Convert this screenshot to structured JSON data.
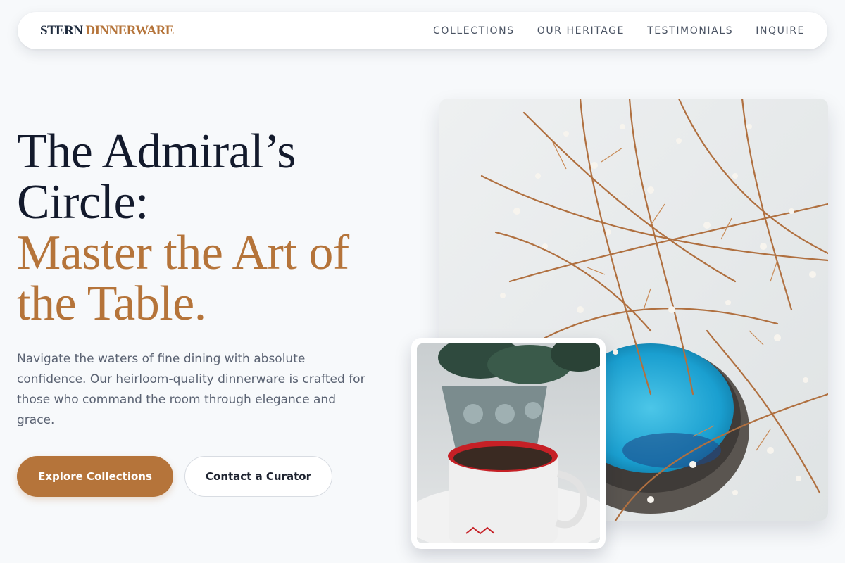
{
  "brand": {
    "part1": "STERN",
    "part2": "DINNERWARE"
  },
  "nav": {
    "items": [
      {
        "label": "COLLECTIONS"
      },
      {
        "label": "OUR HERITAGE"
      },
      {
        "label": "TESTIMONIALS"
      },
      {
        "label": "INQUIRE"
      }
    ]
  },
  "hero": {
    "title_line1": "The Admiral’s",
    "title_line2": "Circle:",
    "accent_line1": "Master the Art of",
    "accent_line2": "the Table.",
    "lede": "Navigate the waters of fine dining with absolute confidence. Our heirloom-quality dinnerware is crafted for those who command the room through elegance and grace.",
    "primary_cta": "Explore Collections",
    "secondary_cta": "Contact a Curator"
  },
  "colors": {
    "accent": "#b5743a",
    "navy": "#131a2c",
    "background": "#f7f9fb"
  },
  "images": {
    "main": "dried-flowers-blue-bowl-photo",
    "inset": "coffee-cup-and-plant-photo"
  }
}
